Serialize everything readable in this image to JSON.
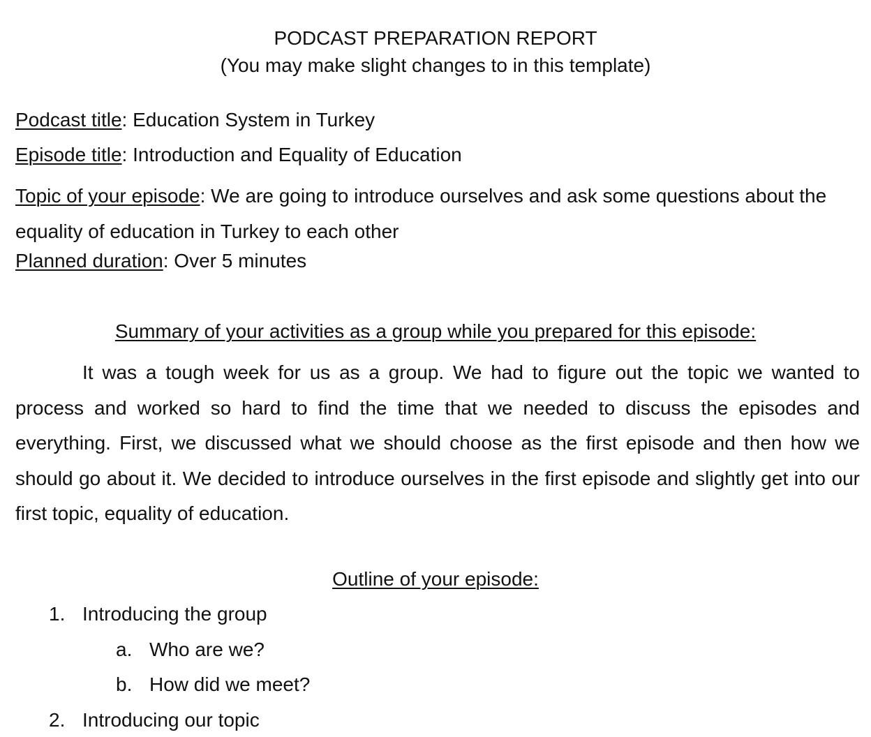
{
  "header": {
    "title": "PODCAST PREPARATION REPORT",
    "subtitle": "(You may make slight changes to in this template)"
  },
  "fields": {
    "podcast_title_label": "Podcast title",
    "podcast_title_value": ": Education System in Turkey",
    "episode_title_label": "Episode title",
    "episode_title_value": ": Introduction and Equality of Education",
    "topic_label": "Topic of your episode",
    "topic_value": ": We are going to introduce ourselves and ask some questions about the equality of education in Turkey to each other",
    "duration_label": "Planned duration",
    "duration_value": ": Over 5 minutes"
  },
  "summary": {
    "heading": "Summary of your activities as a group while you prepared for this episode:",
    "body": "It was a tough week for us as a group. We had to figure out the topic we wanted to process and worked so hard to find the time that we needed to discuss the episodes and everything. First, we discussed what we should choose as the first episode and then how we should go about it. We decided to introduce ourselves in the first episode and slightly get into our first topic, equality of education."
  },
  "outline": {
    "heading": "Outline of your episode:",
    "items": [
      {
        "marker": "1.",
        "text": "Introducing the group"
      },
      {
        "marker": "a.",
        "text": "Who are we?"
      },
      {
        "marker": "b.",
        "text": "How did we meet?"
      },
      {
        "marker": "2.",
        "text": "Introducing our topic"
      }
    ]
  }
}
